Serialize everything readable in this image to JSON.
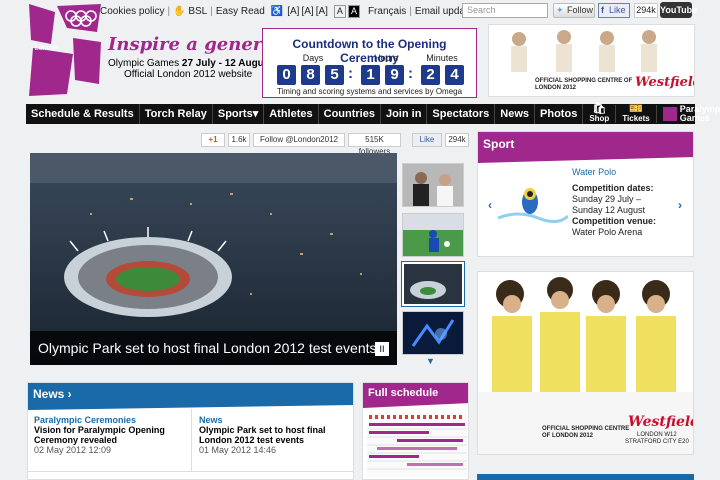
{
  "util": {
    "cookies": "Cookies policy",
    "bsl": "BSL",
    "easy_read": "Easy Read",
    "aa1": "[A]",
    "aa2": "[A]",
    "aa3": "[A]",
    "contrast1": "A",
    "contrast2": "A",
    "francais": "Français",
    "email": "Email updates",
    "search_placeholder": "Search",
    "follow": "Follow",
    "like": "Like",
    "like_count": "294k",
    "youtube": "YouTube"
  },
  "brand": {
    "logo_text": "London",
    "tagline": "Inspire a generation",
    "dates_prefix": "Olympic Games",
    "dates": "27 July - 12 August",
    "official": "Official London 2012 website"
  },
  "countdown": {
    "title": "Countdown to the Opening Ceremony",
    "labels": [
      "Days",
      "Hours",
      "Minutes"
    ],
    "days": [
      "0",
      "8",
      "5"
    ],
    "hours": [
      "1",
      "9"
    ],
    "minutes": [
      "2",
      "4"
    ],
    "footer": "Timing and scoring systems and services by Omega"
  },
  "ad_top": {
    "line1": "OFFICIAL SHOPPING CENTRE OF",
    "line2": "LONDON 2012",
    "brand": "Westfield"
  },
  "nav": {
    "items": [
      "Schedule & Results",
      "Torch Relay",
      "Sports▾",
      "Athletes",
      "Countries",
      "Join in",
      "Spectators",
      "News",
      "Photos"
    ],
    "shop": "Shop",
    "tickets": "Tickets",
    "paralympic": "Paralympic",
    "games": "Games"
  },
  "social": {
    "gplus": "+1",
    "gplus_count": "1.6k",
    "follow": "Follow @London2012",
    "followers": "515K followers",
    "like": "Like",
    "like_count": "294k"
  },
  "hero": {
    "caption": "Olympic Park set to host final London 2012 test events",
    "pause": "II"
  },
  "sport": {
    "header": "Sport",
    "name": "Water Polo",
    "dates_label": "Competition dates:",
    "dates": "Sunday 29 July –",
    "dates2": "Sunday 12 August",
    "venue_label": "Competition venue:",
    "venue": "Water Polo Arena"
  },
  "ad_side": {
    "line1": "OFFICIAL SHOPPING CENTRE",
    "line2": "OF LONDON 2012",
    "brand": "Westfield",
    "addr1": "LONDON W12",
    "addr2": "STRATFORD CITY E20"
  },
  "news": {
    "header": "News ›",
    "items": [
      {
        "cat": "Paralympic Ceremonies",
        "title": "Vision for Paralympic Opening Ceremony revealed",
        "date": "02 May 2012 12:09"
      },
      {
        "cat": "News",
        "title": "Olympic Park set to host final London 2012 test events",
        "date": "01 May 2012 14:46"
      }
    ]
  },
  "schedule": {
    "header": "Full schedule"
  },
  "colors": {
    "purple": "#a0288c",
    "blue": "#1a6aaa",
    "navy": "#1e3a8a"
  }
}
